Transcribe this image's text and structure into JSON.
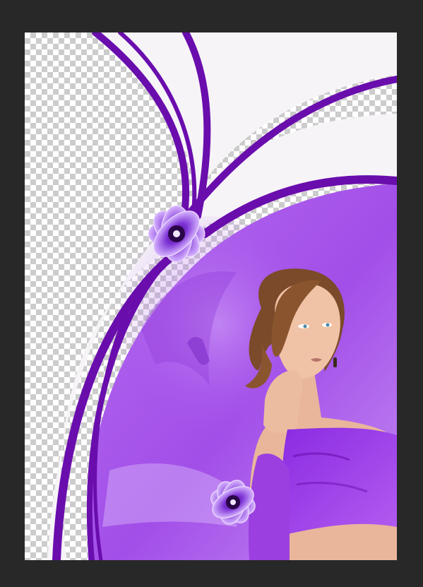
{
  "app": {
    "workspace_label": "",
    "document_label": ""
  },
  "colors": {
    "workspace_bg": "#282828",
    "transparency_light": "#ffffff",
    "transparency_dark": "#cccccc",
    "purple_deep": "#6a0dad",
    "purple_mid": "#9b3fe0",
    "purple_soft": "#c58cf5",
    "lavender": "#d9b8fb",
    "off_white": "#f7f4f8",
    "skin": "#e9b69b",
    "hair": "#7a4a2a"
  },
  "icons": {
    "flower_large": "purple-flower-icon",
    "flower_small": "purple-flower-icon"
  },
  "artwork": {
    "layers": [
      "transparency-checkerboard",
      "white-swoosh-shapes",
      "purple-ribbon-strokes",
      "purple-photo-overlay",
      "woman-portrait",
      "flower-decorations"
    ]
  }
}
